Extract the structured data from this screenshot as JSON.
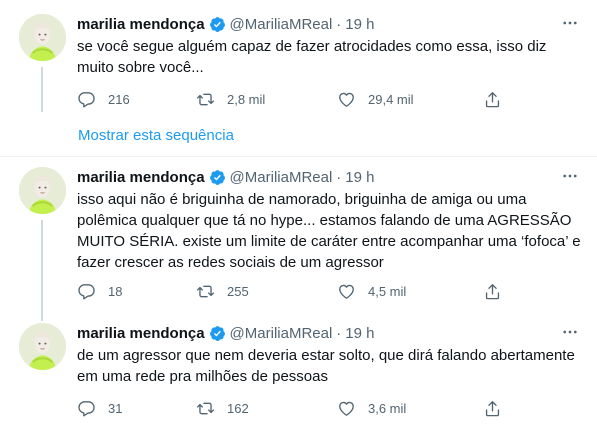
{
  "show_thread_label": "Mostrar esta sequência",
  "colors": {
    "accent": "#1d9bf0",
    "secondary_text": "#536471",
    "avatar_outfit": "#c3ef4f"
  },
  "tweets": [
    {
      "name": "marilia mendonça",
      "handle": "@MariliaMReal",
      "dot": "·",
      "time": "19 h",
      "text": "se você segue alguém capaz de fazer atrocidades como essa, isso diz muito sobre você...",
      "replies": "216",
      "retweets": "2,8 mil",
      "likes": "29,4 mil"
    },
    {
      "name": "marilia mendonça",
      "handle": "@MariliaMReal",
      "dot": "·",
      "time": "19 h",
      "text": "isso aqui não é briguinha de namorado, briguinha de amiga ou uma polêmica qualquer que tá no hype... estamos falando de uma AGRESSÃO MUITO SÉRIA. existe um limite de caráter entre acompanhar uma ‘fofoca’ e fazer crescer as redes sociais de um agressor",
      "replies": "18",
      "retweets": "255",
      "likes": "4,5 mil"
    },
    {
      "name": "marilia mendonça",
      "handle": "@MariliaMReal",
      "dot": "·",
      "time": "19 h",
      "text": "de um agressor que nem deveria estar solto, que dirá falando abertamente em uma rede pra milhões de pessoas",
      "replies": "31",
      "retweets": "162",
      "likes": "3,6 mil"
    }
  ]
}
